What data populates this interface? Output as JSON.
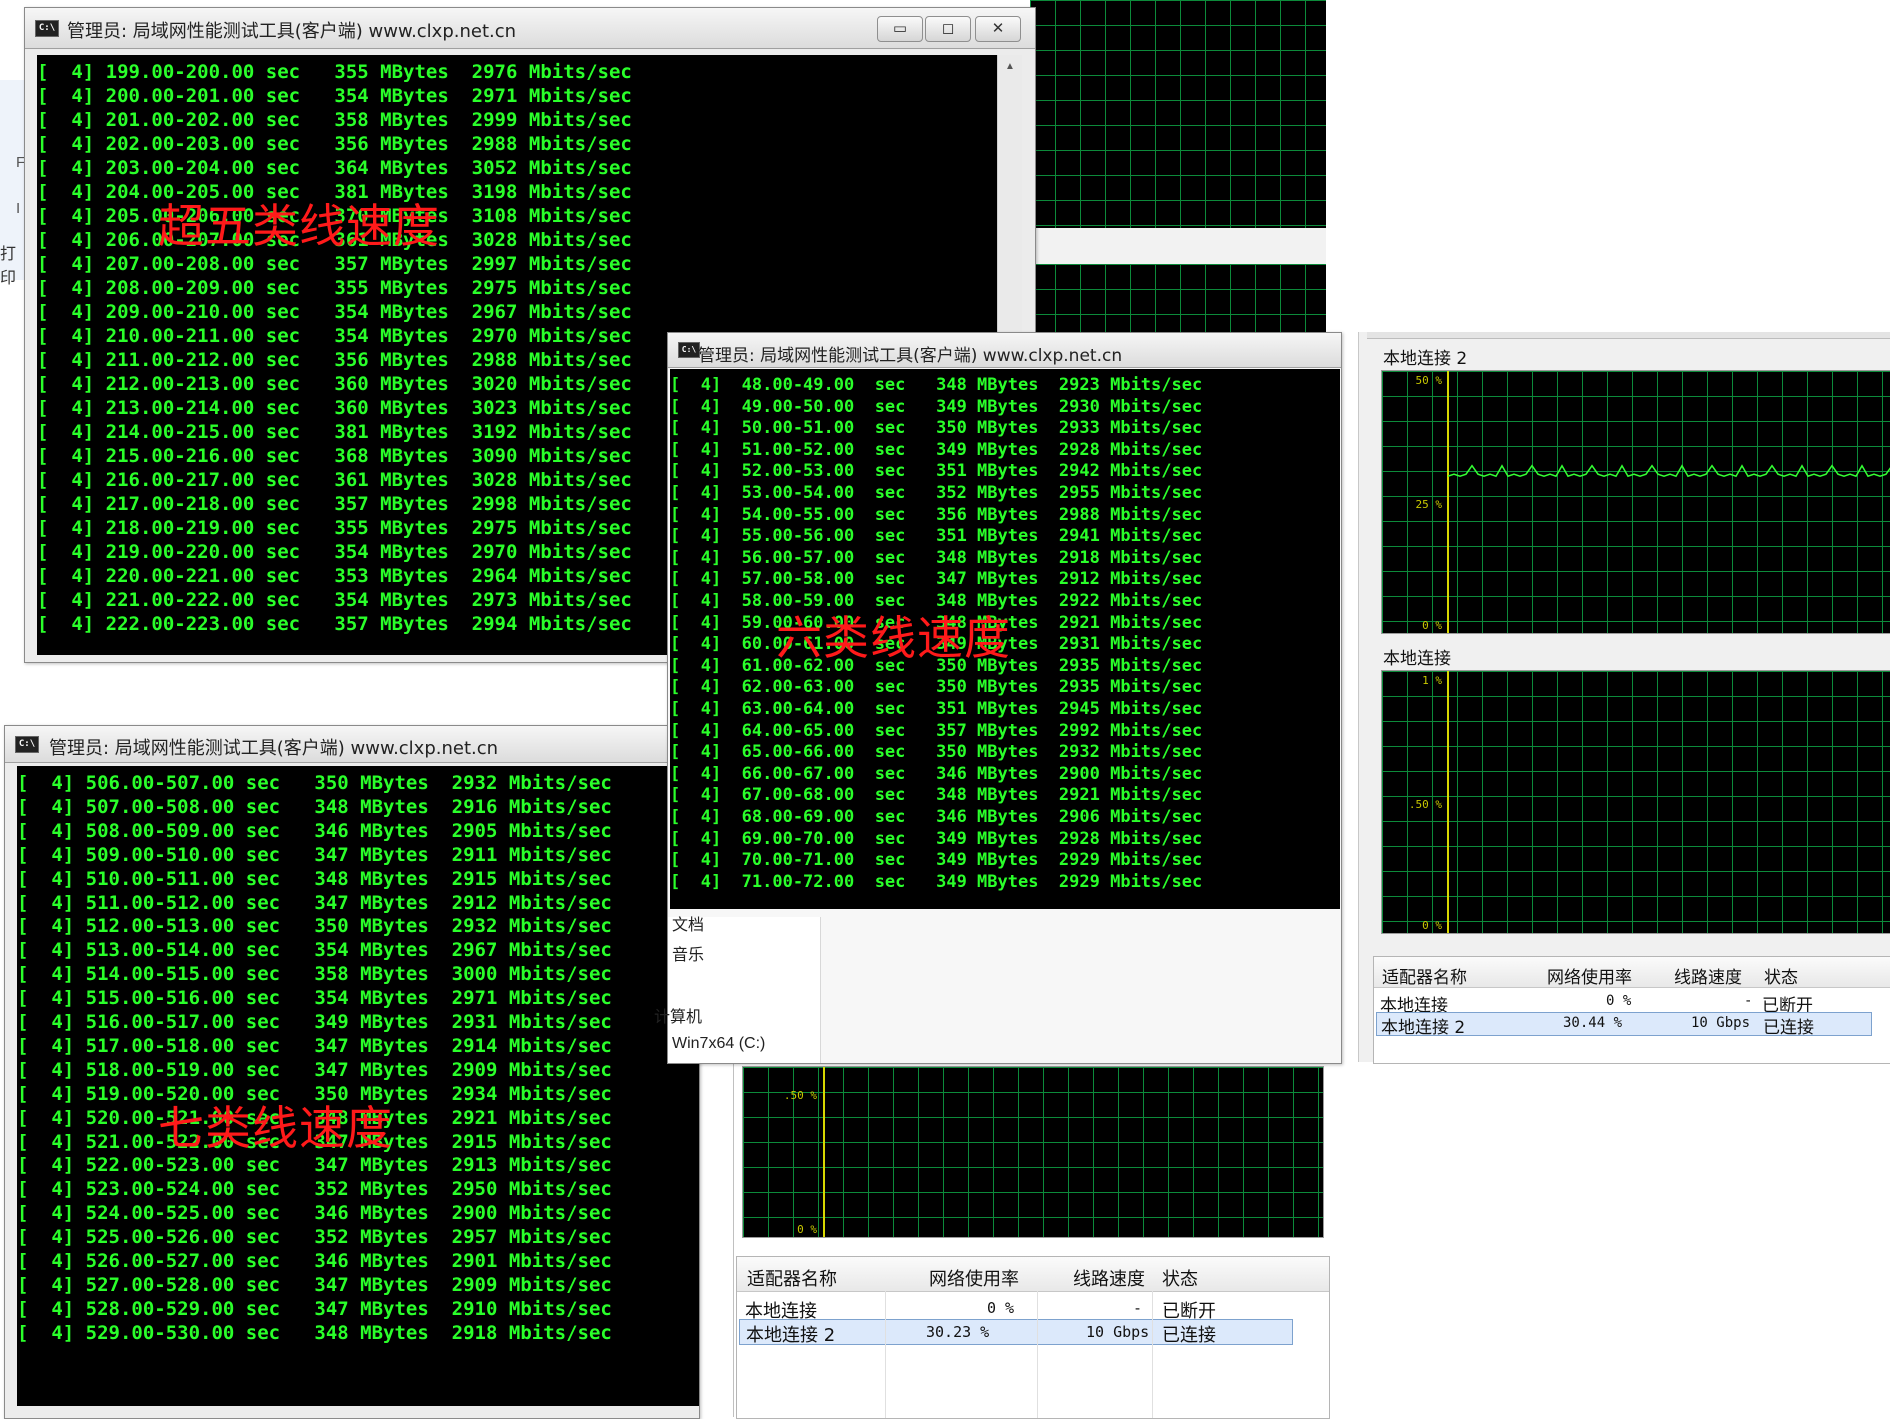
{
  "win1": {
    "title": "管理员: 局域网性能测试工具(客户端) www.clxp.net.cn",
    "lines": [
      "[  4] 199.00-200.00 sec   355 MBytes  2976 Mbits/sec",
      "[  4] 200.00-201.00 sec   354 MBytes  2971 Mbits/sec",
      "[  4] 201.00-202.00 sec   358 MBytes  2999 Mbits/sec",
      "[  4] 202.00-203.00 sec   356 MBytes  2988 Mbits/sec",
      "[  4] 203.00-204.00 sec   364 MBytes  3052 Mbits/sec",
      "[  4] 204.00-205.00 sec   381 MBytes  3198 Mbits/sec",
      "[  4] 205.00-206.00 sec   370 MBytes  3108 Mbits/sec",
      "[  4] 206.00-207.00 sec   361 MBytes  3028 Mbits/sec",
      "[  4] 207.00-208.00 sec   357 MBytes  2997 Mbits/sec",
      "[  4] 208.00-209.00 sec   355 MBytes  2975 Mbits/sec",
      "[  4] 209.00-210.00 sec   354 MBytes  2967 Mbits/sec",
      "[  4] 210.00-211.00 sec   354 MBytes  2970 Mbits/sec",
      "[  4] 211.00-212.00 sec   356 MBytes  2988 Mbits/sec",
      "[  4] 212.00-213.00 sec   360 MBytes  3020 Mbits/sec",
      "[  4] 213.00-214.00 sec   360 MBytes  3023 Mbits/sec",
      "[  4] 214.00-215.00 sec   381 MBytes  3192 Mbits/sec",
      "[  4] 215.00-216.00 sec   368 MBytes  3090 Mbits/sec",
      "[  4] 216.00-217.00 sec   361 MBytes  3028 Mbits/sec",
      "[  4] 217.00-218.00 sec   357 MBytes  2998 Mbits/sec",
      "[  4] 218.00-219.00 sec   355 MBytes  2975 Mbits/sec",
      "[  4] 219.00-220.00 sec   354 MBytes  2970 Mbits/sec",
      "[  4] 220.00-221.00 sec   353 MBytes  2964 Mbits/sec",
      "[  4] 221.00-222.00 sec   354 MBytes  2973 Mbits/sec",
      "[  4] 222.00-223.00 sec   357 MBytes  2994 Mbits/sec"
    ],
    "overlay": "超五类线速度",
    "btn_min": "▭",
    "btn_max": "◻",
    "btn_close": "✕"
  },
  "win2": {
    "title": "管理员: 局域网性能测试工具(客户端) www.clxp.net.cn",
    "lines": [
      "[  4]  48.00-49.00  sec   348 MBytes  2923 Mbits/sec",
      "[  4]  49.00-50.00  sec   349 MBytes  2930 Mbits/sec",
      "[  4]  50.00-51.00  sec   350 MBytes  2933 Mbits/sec",
      "[  4]  51.00-52.00  sec   349 MBytes  2928 Mbits/sec",
      "[  4]  52.00-53.00  sec   351 MBytes  2942 Mbits/sec",
      "[  4]  53.00-54.00  sec   352 MBytes  2955 Mbits/sec",
      "[  4]  54.00-55.00  sec   356 MBytes  2988 Mbits/sec",
      "[  4]  55.00-56.00  sec   351 MBytes  2941 Mbits/sec",
      "[  4]  56.00-57.00  sec   348 MBytes  2918 Mbits/sec",
      "[  4]  57.00-58.00  sec   347 MBytes  2912 Mbits/sec",
      "[  4]  58.00-59.00  sec   348 MBytes  2922 Mbits/sec",
      "[  4]  59.00-60.00  sec   348 MBytes  2921 Mbits/sec",
      "[  4]  60.00-61.00  sec   349 MBytes  2931 Mbits/sec",
      "[  4]  61.00-62.00  sec   350 MBytes  2935 Mbits/sec",
      "[  4]  62.00-63.00  sec   350 MBytes  2935 Mbits/sec",
      "[  4]  63.00-64.00  sec   351 MBytes  2945 Mbits/sec",
      "[  4]  64.00-65.00  sec   357 MBytes  2992 Mbits/sec",
      "[  4]  65.00-66.00  sec   350 MBytes  2932 Mbits/sec",
      "[  4]  66.00-67.00  sec   346 MBytes  2900 Mbits/sec",
      "[  4]  67.00-68.00  sec   348 MBytes  2921 Mbits/sec",
      "[  4]  68.00-69.00  sec   346 MBytes  2906 Mbits/sec",
      "[  4]  69.00-70.00  sec   349 MBytes  2928 Mbits/sec",
      "[  4]  70.00-71.00  sec   349 MBytes  2929 Mbits/sec",
      "[  4]  71.00-72.00  sec   349 MBytes  2929 Mbits/sec"
    ],
    "overlay": "六类线速度"
  },
  "win3": {
    "title": "管理员: 局域网性能测试工具(客户端) www.clxp.net.cn",
    "lines": [
      "[  4] 506.00-507.00 sec   350 MBytes  2932 Mbits/sec",
      "[  4] 507.00-508.00 sec   348 MBytes  2916 Mbits/sec",
      "[  4] 508.00-509.00 sec   346 MBytes  2905 Mbits/sec",
      "[  4] 509.00-510.00 sec   347 MBytes  2911 Mbits/sec",
      "[  4] 510.00-511.00 sec   348 MBytes  2915 Mbits/sec",
      "[  4] 511.00-512.00 sec   347 MBytes  2912 Mbits/sec",
      "[  4] 512.00-513.00 sec   350 MBytes  2932 Mbits/sec",
      "[  4] 513.00-514.00 sec   354 MBytes  2967 Mbits/sec",
      "[  4] 514.00-515.00 sec   358 MBytes  3000 Mbits/sec",
      "[  4] 515.00-516.00 sec   354 MBytes  2971 Mbits/sec",
      "[  4] 516.00-517.00 sec   349 MBytes  2931 Mbits/sec",
      "[  4] 517.00-518.00 sec   347 MBytes  2914 Mbits/sec",
      "[  4] 518.00-519.00 sec   347 MBytes  2909 Mbits/sec",
      "[  4] 519.00-520.00 sec   350 MBytes  2934 Mbits/sec",
      "[  4] 520.00-521.00 sec   348 MBytes  2921 Mbits/sec",
      "[  4] 521.00-522.00 sec   347 MBytes  2915 Mbits/sec",
      "[  4] 522.00-523.00 sec   347 MBytes  2913 Mbits/sec",
      "[  4] 523.00-524.00 sec   352 MBytes  2950 Mbits/sec",
      "[  4] 524.00-525.00 sec   346 MBytes  2900 Mbits/sec",
      "[  4] 525.00-526.00 sec   352 MBytes  2957 Mbits/sec",
      "[  4] 526.00-527.00 sec   346 MBytes  2901 Mbits/sec",
      "[  4] 527.00-528.00 sec   347 MBytes  2909 Mbits/sec",
      "[  4] 528.00-529.00 sec   347 MBytes  2910 Mbits/sec",
      "[  4] 529.00-530.00 sec   348 MBytes  2918 Mbits/sec"
    ],
    "overlay": "七类线速度"
  },
  "monitor_right": {
    "graph1_title": "本地连接 2",
    "graph1_labels": [
      "50 %",
      "25 %",
      "0 %"
    ],
    "graph1_usage_percent": 30.44,
    "graph2_title": "本地连接",
    "graph2_labels": [
      "1 %",
      ".50 %",
      "0 %"
    ],
    "headers": [
      "适配器名称",
      "网络使用率",
      "线路速度",
      "状态"
    ],
    "rows": [
      [
        "本地连接",
        "0 %",
        "-",
        "已断开"
      ],
      [
        "本地连接 2",
        "30.44 %",
        "10 Gbps",
        "已连接"
      ]
    ]
  },
  "monitor_bottom": {
    "graph_labels": [
      ".50 %",
      "0 %"
    ],
    "headers": [
      "适配器名称",
      "网络使用率",
      "线路速度",
      "状态"
    ],
    "rows": [
      [
        "本地连接",
        "0 %",
        "-",
        "已断开"
      ],
      [
        "本地连接 2",
        "30.23 %",
        "10 Gbps",
        "已连接"
      ]
    ]
  },
  "explorer": {
    "items": [
      "文档",
      "音乐",
      "计算机",
      "Win7x64 (C:)"
    ]
  },
  "left_fragments": [
    "F",
    "I",
    "打印"
  ],
  "colors": {
    "console_text": "#2aff2a",
    "overlay_red": "#ff1a1a",
    "grid_green": "#0c8a3a",
    "usage_line": "#33ff33"
  }
}
